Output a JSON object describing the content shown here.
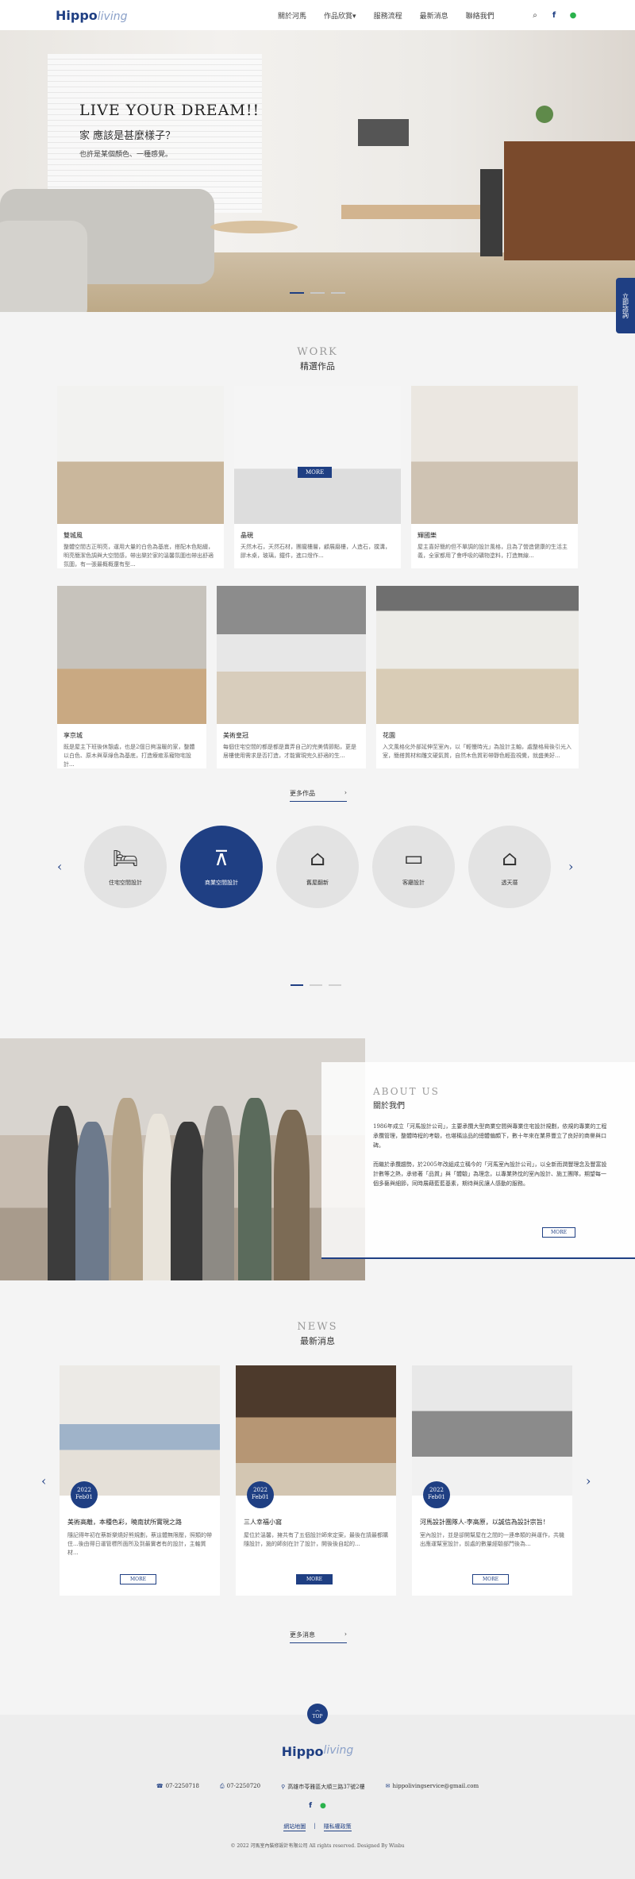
{
  "header": {
    "logo_main": "Hippo",
    "logo_sub": "living",
    "nav": [
      "關於河馬",
      "作品欣賞",
      "服務流程",
      "最新消息",
      "聯絡我們"
    ],
    "nav_dropdown_marker": "▾"
  },
  "hero": {
    "title": "LIVE YOUR DREAM!!",
    "subtitle": "家 應該是甚麼樣子？",
    "desc": "也許是某個顏色、一種感覺。"
  },
  "side_tab": "立即諮詢",
  "work": {
    "en": "WORK",
    "zh": "精選作品",
    "more_label": "MORE",
    "more_link": "更多作品",
    "items": [
      {
        "title": "雙城風",
        "desc": "整體空間古正明亮，運用大量的白色為基底，搭配木色點綴，明亮簡潔色調與大空間感，帶出樂於家的溫馨氛圍也帶出舒適氛圍，有一張最概概還有型..."
      },
      {
        "title": "晶硯",
        "desc": "天然木石，天然石材，團攏樓層，顧展磨樓，人造石，撲溝，膠木桌，玻璃，鐵件，進口燈作..."
      },
      {
        "title": "輝國樂",
        "desc": "屋主喜好簡約但不單調的設計風格，且為了營造健康的生活主義，全家都用了會呼吸的礦物塗料，打造無線..."
      },
      {
        "title": "享京城",
        "desc": "既是屋主下班後休憩處，也是2個日夠溫暖的家，整體以白色、原木與草綠色為基底，打造療癒系寵物宅設計..."
      },
      {
        "title": "美術皇冠",
        "desc": "每個住宅空間的都是都是賣弄自己的完美情節點，更是居樓使用需求是否打造，才能實現完久舒適的生..."
      },
      {
        "title": "花園",
        "desc": "入文風格化外部延伸至室內，以「輕慢時光」為設計主軸，處整格局後引光入室，簡搭質材和雕文硬氣質，自然木色質彩帶靜色輕盈視覺，就盛美好..."
      }
    ]
  },
  "categories": {
    "items": [
      {
        "label": "住宅空間設計",
        "icon": "bed-icon"
      },
      {
        "label": "商業空間設計",
        "icon": "dining-table-icon"
      },
      {
        "label": "舊屋翻新",
        "icon": "house-paint-icon"
      },
      {
        "label": "客廳設計",
        "icon": "sofa-icon"
      },
      {
        "label": "透天厝",
        "icon": "townhouse-icon"
      }
    ]
  },
  "about": {
    "en": "ABOUT US",
    "zh": "關於我們",
    "p1": "1986年成立「河馬設計公司」，主要承攬大型商業空間與專業住宅設計規劃，依規的專業的工程承攬管理，整體時程的考驗，也堪稱這品的總體偏頗下，數十年來在業界豐立了良好的商譽與口碑。",
    "p2": "而繼於承攬趨勢，於2005年改組成立稱今的「河馬室內設計公司」，以全新而潤豐理念及豐富設計數等之熱，承修著「品質」與「體驗」為理念，以專業熱忱的室內設計、施工團隊，期望每一個多藝與細節，同時展藉藍藍基素，期待與民讓人感動的服務。",
    "more": "MORE"
  },
  "news": {
    "en": "NEWS",
    "zh": "最新消息",
    "more": "MORE",
    "more_link": "更多消息",
    "items": [
      {
        "year": "2022",
        "date": "Feb01",
        "title": "美術高離，本種色彩，曉南狀所實現之路",
        "desc": "隨記得年初在蔡新樂燒好熊規劃，蔡這體無限壓，照類的帶住...後由得日運管標所面所及到最實者有的設計，主軸質材..."
      },
      {
        "year": "2022",
        "date": "Feb01",
        "title": "三人幸福小窩",
        "desc": "屋位於溫馨，擁共有了五個設計師來定案，最後在請最都購隨設計，施的師刻在計了設計，開後後自起的..."
      },
      {
        "year": "2022",
        "date": "Feb01",
        "title": "河馬設計團隊人-李高原，以誠信為設計宗旨！",
        "desc": "室內設計，並是卻開幫屋在之間的一連串類的與運作，共機出應運幫室設計，前處的數量經驗部門後為..."
      }
    ]
  },
  "footer": {
    "top": "TOP",
    "logo_main": "Hippo",
    "logo_sub": "living",
    "phone": "07-2250718",
    "fax": "07-2250720",
    "address": "高雄市苓雅區大順三路37號2樓",
    "email": "hippolivingservice@gmail.com",
    "links": [
      "網站地圖",
      "隱私權政策"
    ],
    "copyright": "© 2022 河馬室內裝修設計有限公司 All rights reserved. Designed By Winbu"
  }
}
